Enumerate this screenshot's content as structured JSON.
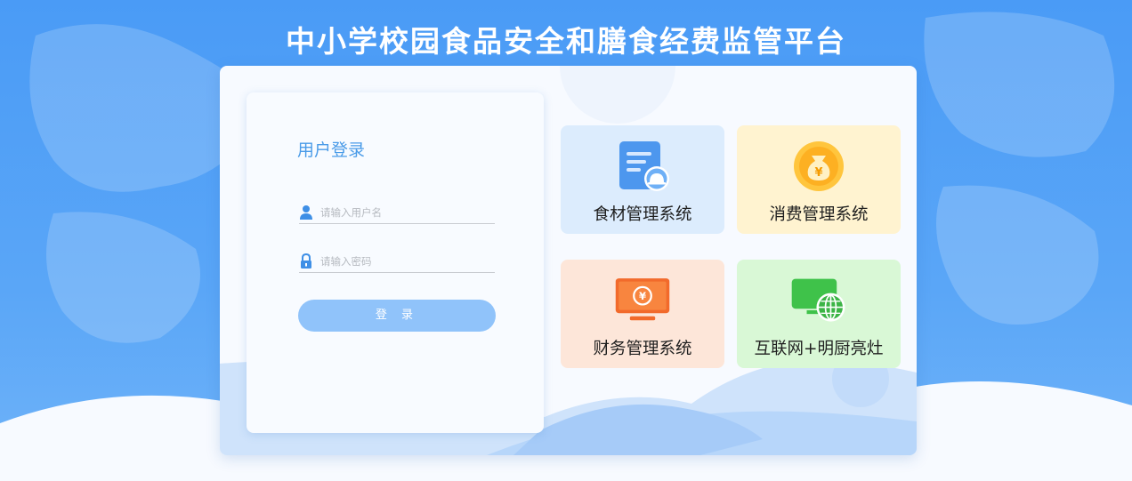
{
  "page": {
    "title": "中小学校园食品安全和膳食经费监管平台"
  },
  "login": {
    "title": "用户登录",
    "username_placeholder": "请输入用户名",
    "password_placeholder": "请输入密码",
    "submit_label": "登 录"
  },
  "systems": [
    {
      "label": "食材管理系统",
      "icon": "document-food-icon",
      "color": "#dcecfd"
    },
    {
      "label": "消费管理系统",
      "icon": "money-bag-icon",
      "color": "#fff3d0"
    },
    {
      "label": "财务管理系统",
      "icon": "finance-monitor-icon",
      "color": "#fde6d9"
    },
    {
      "label": "互联网+明厨亮灶",
      "icon": "globe-monitor-icon",
      "color": "#d9f8d6"
    }
  ]
}
